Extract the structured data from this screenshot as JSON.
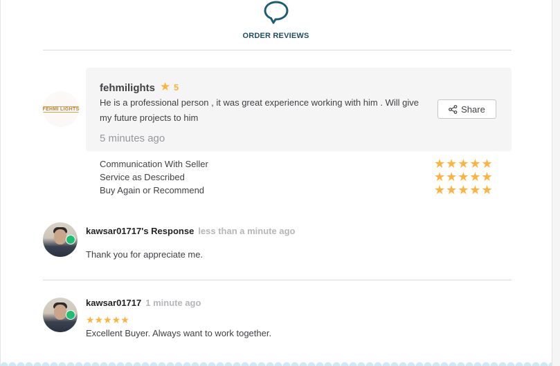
{
  "header": {
    "title": "ORDER REVIEWS",
    "icon": "chat-bubble-icon",
    "accent": "#1d5d74"
  },
  "seller_review": {
    "logo_text": "FEHMI LIGHTS",
    "name": "fehmilights",
    "rating": "5",
    "text": "He is a professional person , it was great experience working with him . Will give my future projects to him",
    "time": "5 minutes ago",
    "share_label": "Share",
    "star_color": "#ffb33e",
    "breakdown": [
      {
        "label": "Communication With Seller",
        "stars": "★★★★★",
        "rating": 5
      },
      {
        "label": "Service as Described",
        "stars": "★★★★★",
        "rating": 5
      },
      {
        "label": "Buy Again or Recommend",
        "stars": "★★★★★",
        "rating": 5
      }
    ]
  },
  "response": {
    "title": "kawsar01717's Response",
    "time": "less than a minute ago",
    "text": "Thank you for appreciate me."
  },
  "buyer_review": {
    "name": "kawsar01717",
    "time": "1 minute ago",
    "stars": "★★★★★",
    "rating": 5,
    "text": "Excellent Buyer. Always want to work together."
  }
}
